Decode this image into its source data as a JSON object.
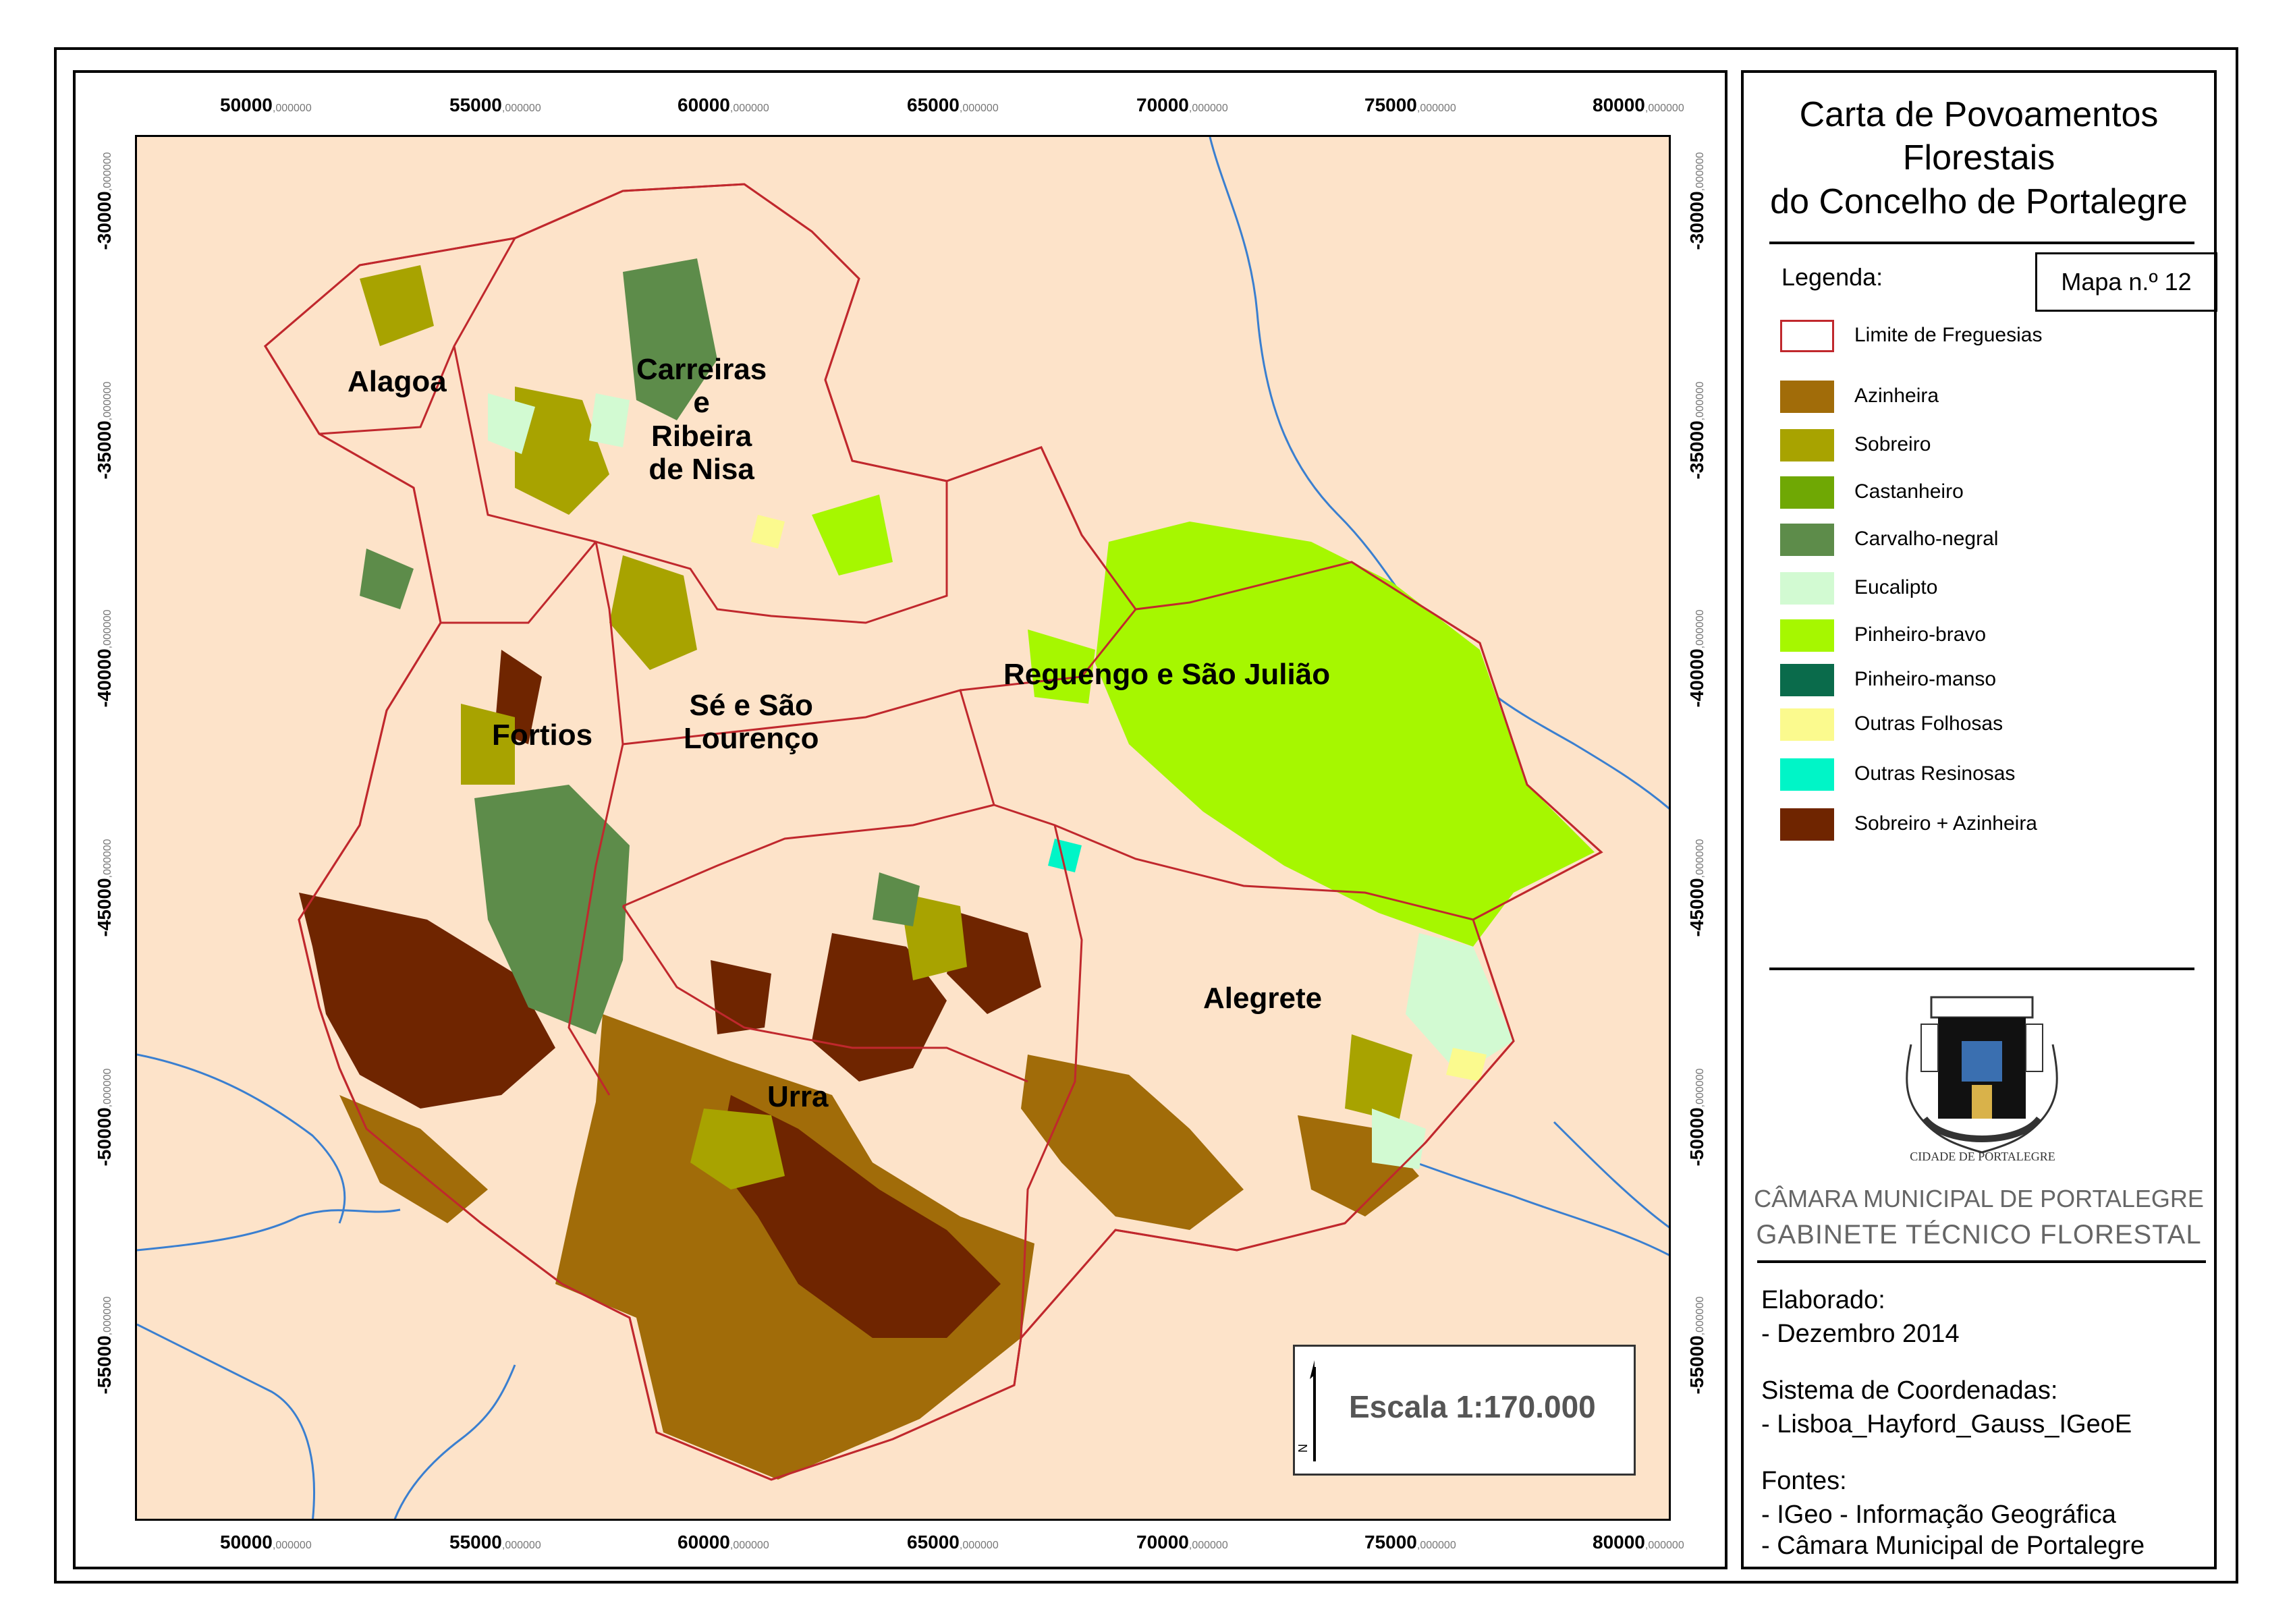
{
  "title": {
    "line1": "Carta de Povoamentos",
    "line2": "Florestais",
    "line3": "do Concelho de Portalegre"
  },
  "legend": {
    "heading": "Legenda:",
    "map_number": "Mapa n.º 12",
    "items": [
      {
        "label": "Limite de Freguesias",
        "color": "#ffffff",
        "outline": "#c0282d"
      },
      {
        "label": "Azinheira",
        "color": "#a16c09"
      },
      {
        "label": "Sobreiro",
        "color": "#a8a300"
      },
      {
        "label": "Castanheiro",
        "color": "#6fa804"
      },
      {
        "label": "Carvalho-negral",
        "color": "#5d8c4a"
      },
      {
        "label": "Eucalipto",
        "color": "#d2fad2"
      },
      {
        "label": "Pinheiro-bravo",
        "color": "#a6f700"
      },
      {
        "label": "Pinheiro-manso",
        "color": "#0a6b4b"
      },
      {
        "label": "Outras Folhosas",
        "color": "#fbfa8e"
      },
      {
        "label": "Outras Resinosas",
        "color": "#00f5c7"
      },
      {
        "label": "Sobreiro + Azinheira",
        "color": "#6f2500"
      }
    ]
  },
  "map": {
    "background_color": "#fde3c9",
    "river_color": "#3a7fd0",
    "boundary_color": "#c0282d",
    "freguesias": [
      {
        "name": "Alagoa"
      },
      {
        "name": "Carreiras\ne\nRibeira\nde Nisa"
      },
      {
        "name": "Fortios"
      },
      {
        "name": "Sé e São\nLourenço"
      },
      {
        "name": "Reguengo e São Julião"
      },
      {
        "name": "Alegrete"
      },
      {
        "name": "Urra"
      }
    ],
    "x_ticks": [
      {
        "value": "50000",
        "decimals": ",000000"
      },
      {
        "value": "55000",
        "decimals": ",000000"
      },
      {
        "value": "60000",
        "decimals": ",000000"
      },
      {
        "value": "65000",
        "decimals": ",000000"
      },
      {
        "value": "70000",
        "decimals": ",000000"
      },
      {
        "value": "75000",
        "decimals": ",000000"
      },
      {
        "value": "80000",
        "decimals": ",000000"
      }
    ],
    "y_ticks": [
      {
        "value": "-30000",
        "decimals": ",000000"
      },
      {
        "value": "-35000",
        "decimals": ",000000"
      },
      {
        "value": "-40000",
        "decimals": ",000000"
      },
      {
        "value": "-45000",
        "decimals": ",000000"
      },
      {
        "value": "-50000",
        "decimals": ",000000"
      },
      {
        "value": "-55000",
        "decimals": ",000000"
      }
    ],
    "scale": "Escala 1:170.000",
    "north_letter": "N"
  },
  "organization": {
    "line1": "CÂMARA MUNICIPAL DE PORTALEGRE",
    "line2": "GABINETE TÉCNICO FLORESTAL",
    "crest_text": "CIDADE DE PORTALEGRE"
  },
  "info": {
    "elaborado_label": "Elaborado:",
    "elaborado_value": "- Dezembro 2014",
    "sistema_label": "Sistema de Coordenadas:",
    "sistema_value": "- Lisboa_Hayford_Gauss_IGeoE",
    "fontes_label": "Fontes:",
    "fonte_1": "- IGeo - Informação Geográfica",
    "fonte_2": "- Câmara Municipal de Portalegre"
  }
}
